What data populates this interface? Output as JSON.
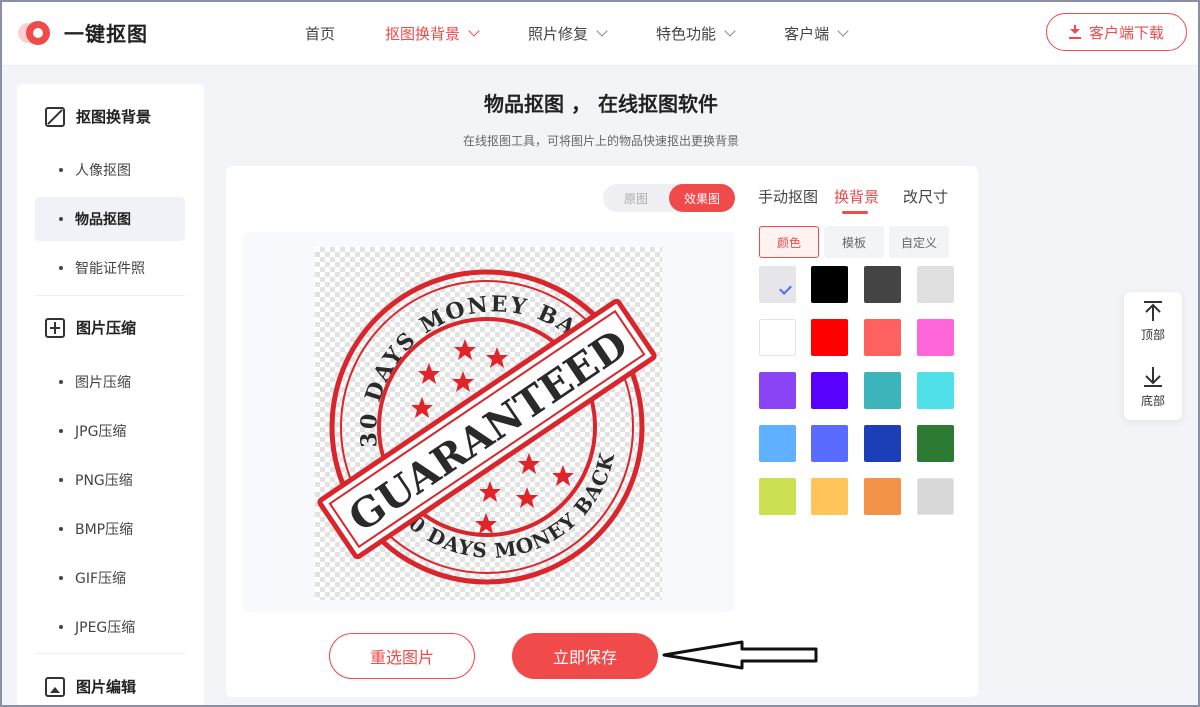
{
  "app": {
    "title": "一键抠图"
  },
  "nav": [
    {
      "label": "首页",
      "active": false,
      "dropdown": false
    },
    {
      "label": "抠图换背景",
      "active": true,
      "dropdown": true
    },
    {
      "label": "照片修复",
      "active": false,
      "dropdown": true
    },
    {
      "label": "特色功能",
      "active": false,
      "dropdown": true
    },
    {
      "label": "客户端",
      "active": false,
      "dropdown": true
    }
  ],
  "header": {
    "download_label": "客户端下载"
  },
  "sidebar": {
    "sections": [
      {
        "label": "抠图换背景",
        "icon": "cutout-icon"
      },
      {
        "label": "图片压缩",
        "icon": "compress-icon"
      },
      {
        "label": "图片编辑",
        "icon": "image-edit-icon"
      }
    ],
    "items": [
      {
        "label": "人像抠图"
      },
      {
        "label": "物品抠图"
      },
      {
        "label": "智能证件照"
      },
      {
        "label": "图片压缩"
      },
      {
        "label": "JPG压缩"
      },
      {
        "label": "PNG压缩"
      },
      {
        "label": "BMP压缩"
      },
      {
        "label": "GIF压缩"
      },
      {
        "label": "JPEG压缩"
      }
    ],
    "active_item": "物品抠图"
  },
  "main": {
    "title": "物品抠图 ， 在线抠图软件",
    "subtitle": "在线抠图工具，可将图片上的物品快速抠出更换背景",
    "toggle": {
      "original": "原图",
      "result": "效果图",
      "selected": "效果图"
    },
    "stamp": {
      "top_arc": "30 DAYS MONEY BACK",
      "right_arc": "30 DAYS MONEY BACK",
      "bottom_arc": "30 DAYS MONEY BACK",
      "banner": "GUARANTEED",
      "colors": {
        "ring": "#d8262c",
        "text": "#2a2a2a",
        "star": "#e0242a"
      }
    },
    "buttons": {
      "reselect": "重选图片",
      "save": "立即保存"
    }
  },
  "editor": {
    "tabs": [
      {
        "label": "手动抠图",
        "active": false
      },
      {
        "label": "换背景",
        "active": true
      },
      {
        "label": "改尺寸",
        "active": false
      }
    ],
    "subtabs": [
      {
        "label": "颜色",
        "active": true
      },
      {
        "label": "模板",
        "active": false
      },
      {
        "label": "自定义",
        "active": false
      }
    ],
    "swatches": [
      "#e6e6ea",
      "#000000",
      "#444444",
      "#e0e0e0",
      "#ffffff",
      "#ff0000",
      "#ff6060",
      "#ff66d9",
      "#8b44f5",
      "#5a00ff",
      "#3bb4bb",
      "#4fe0ea",
      "#5fb0ff",
      "#5a6bff",
      "#1c3fb8",
      "#2d7a32",
      "#cde052",
      "#ffc55a",
      "#f39349",
      "#d8d8d8"
    ],
    "selected_swatch": 0
  },
  "float": {
    "top": "顶部",
    "bottom": "底部"
  },
  "colors": {
    "accent": "#f04a4a",
    "check": "#4b6bff"
  }
}
